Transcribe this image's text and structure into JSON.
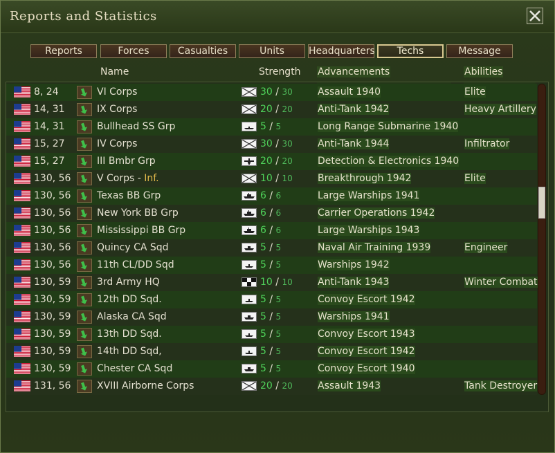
{
  "window": {
    "title": "Reports and Statistics"
  },
  "tabs": [
    {
      "label": "Reports"
    },
    {
      "label": "Forces"
    },
    {
      "label": "Casualties"
    },
    {
      "label": "Units"
    },
    {
      "label": "Headquarters"
    },
    {
      "label": "Techs",
      "active": true
    },
    {
      "label": "Message"
    }
  ],
  "columns": {
    "name": "Name",
    "strength": "Strength",
    "advancements": "Advancements",
    "abilities": "Abilities"
  },
  "rows": [
    {
      "coord": "8, 24",
      "name": "VI Corps",
      "unit": "infantry",
      "cur": "30",
      "max": "30",
      "adv": "Assault 1940",
      "abl": "Elite"
    },
    {
      "coord": "14, 31",
      "name": "IX Corps",
      "unit": "infantry",
      "cur": "20",
      "max": "20",
      "adv": "Anti-Tank 1942",
      "abl": "Heavy Artillery"
    },
    {
      "coord": "14, 31",
      "name": "Bullhead SS Grp",
      "unit": "submarine",
      "cur": "5",
      "max": "5",
      "adv": "Long Range Submarine 1940",
      "abl": ""
    },
    {
      "coord": "15, 27",
      "name": "IV Corps",
      "unit": "infantry",
      "cur": "30",
      "max": "30",
      "adv": "Anti-Tank 1944",
      "abl": "Infiltrator"
    },
    {
      "coord": "15, 27",
      "name": "III Bmbr Grp",
      "unit": "bomber",
      "cur": "20",
      "max": "20",
      "adv": "Detection & Electronics 1940",
      "abl": ""
    },
    {
      "coord": "130, 56",
      "name": "V Corps",
      "tag": "Inf.",
      "unit": "infantry",
      "cur": "10",
      "max": "10",
      "adv": "Breakthrough 1942",
      "abl": "Elite"
    },
    {
      "coord": "130, 56",
      "name": "Texas BB Grp",
      "unit": "battleship",
      "cur": "6",
      "max": "6",
      "adv": "Large Warships 1941",
      "abl": ""
    },
    {
      "coord": "130, 56",
      "name": "New York BB Grp",
      "unit": "battleship",
      "cur": "6",
      "max": "6",
      "adv": "Carrier Operations 1942",
      "abl": ""
    },
    {
      "coord": "130, 56",
      "name": "Mississippi BB Grp",
      "unit": "battleship",
      "cur": "6",
      "max": "6",
      "adv": "Large Warships 1943",
      "abl": ""
    },
    {
      "coord": "130, 56",
      "name": "Quincy CA Sqd",
      "unit": "cruiser",
      "cur": "5",
      "max": "5",
      "adv": "Naval Air Training 1939",
      "abl": "Engineer"
    },
    {
      "coord": "130, 56",
      "name": "11th CL/DD Sqd",
      "unit": "destroyer",
      "cur": "5",
      "max": "5",
      "adv": "Warships 1942",
      "abl": ""
    },
    {
      "coord": "130, 59",
      "name": "3rd Army HQ",
      "unit": "hq",
      "cur": "10",
      "max": "10",
      "adv": "Anti-Tank 1943",
      "abl": "Winter Combat"
    },
    {
      "coord": "130, 59",
      "name": "12th DD Sqd.",
      "unit": "destroyer",
      "cur": "5",
      "max": "5",
      "adv": "Convoy Escort 1942",
      "abl": ""
    },
    {
      "coord": "130, 59",
      "name": "Alaska CA Sqd",
      "unit": "cruiser",
      "cur": "5",
      "max": "5",
      "adv": "Warships 1941",
      "abl": ""
    },
    {
      "coord": "130, 59",
      "name": "13th DD Sqd.",
      "unit": "destroyer",
      "cur": "5",
      "max": "5",
      "adv": "Convoy Escort 1943",
      "abl": ""
    },
    {
      "coord": "130, 59",
      "name": "14th DD Sqd,",
      "unit": "destroyer",
      "cur": "5",
      "max": "5",
      "adv": "Convoy Escort 1942",
      "abl": ""
    },
    {
      "coord": "130, 59",
      "name": "Chester CA Sqd",
      "unit": "cruiser",
      "cur": "5",
      "max": "5",
      "adv": "Convoy Escort 1940",
      "abl": ""
    },
    {
      "coord": "131, 56",
      "name": "XVIII Airborne Corps",
      "unit": "infantry",
      "cur": "20",
      "max": "20",
      "adv": "Assault 1943",
      "abl": "Tank Destroyer"
    }
  ]
}
